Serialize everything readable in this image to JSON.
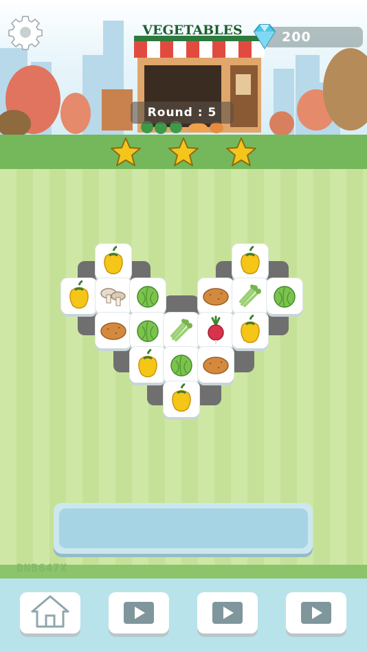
{
  "header": {
    "shop_title": "VEGETABLES",
    "gem_count": "200",
    "round_label": "Round :",
    "round_number": "5",
    "stars": {
      "earned": 3,
      "total": 3
    }
  },
  "board": {
    "tiles": [
      {
        "item": "yellow-pepper"
      },
      {
        "item": "yellow-pepper"
      },
      {
        "item": "yellow-pepper"
      },
      {
        "item": "mushrooms"
      },
      {
        "item": "cabbage"
      },
      {
        "item": "potato"
      },
      {
        "item": "celery"
      },
      {
        "item": "cabbage"
      },
      {
        "item": "potato"
      },
      {
        "item": "cabbage"
      },
      {
        "item": "celery"
      },
      {
        "item": "radish"
      },
      {
        "item": "yellow-pepper"
      },
      {
        "item": "yellow-pepper"
      },
      {
        "item": "cabbage"
      },
      {
        "item": "potato"
      },
      {
        "item": "yellow-pepper"
      }
    ]
  },
  "plate_text": "DNB647X",
  "bottom_bar": {
    "buttons": [
      {
        "icon": "home-icon"
      },
      {
        "icon": "video-icon"
      },
      {
        "icon": "video-icon"
      },
      {
        "icon": "video-icon"
      }
    ]
  },
  "colors": {
    "accent": "#1f5e2f",
    "gem": "#4fc6e8",
    "star": "#f4c51c",
    "tray": "#a6d4e4"
  }
}
